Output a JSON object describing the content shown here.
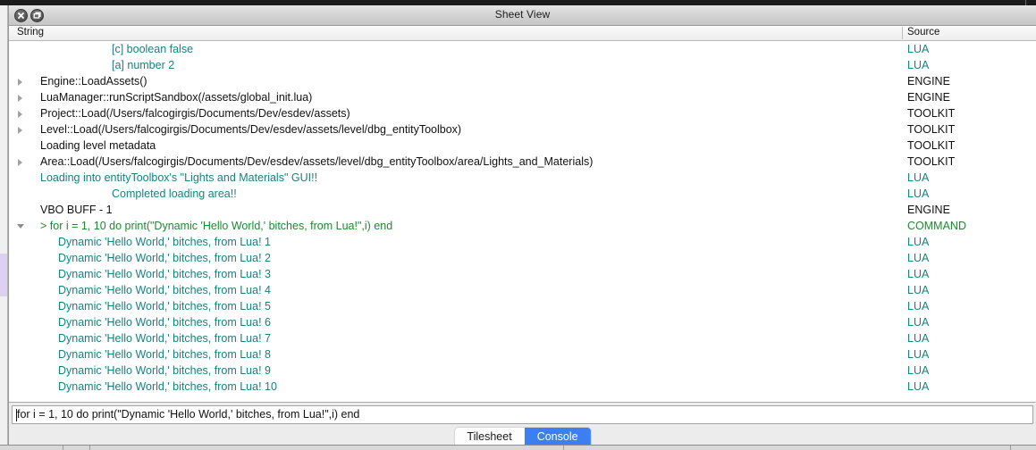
{
  "window": {
    "title": "Sheet View",
    "close_icon": "close-icon",
    "restore_icon": "restore-window-icon"
  },
  "columns": {
    "string": "String",
    "source": "Source"
  },
  "rows": [
    {
      "text": "[c] boolean false",
      "source": "LUA",
      "indent": 3,
      "color": "lua",
      "twisty": "none"
    },
    {
      "text": "[a] number 2",
      "source": "LUA",
      "indent": 3,
      "color": "lua",
      "twisty": "none"
    },
    {
      "text": "Engine::LoadAssets()",
      "source": "ENGINE",
      "indent": 1,
      "color": "plain",
      "twisty": "closed"
    },
    {
      "text": "LuaManager::runScriptSandbox(/assets/global_init.lua)",
      "source": "ENGINE",
      "indent": 1,
      "color": "plain",
      "twisty": "closed"
    },
    {
      "text": "Project::Load(/Users/falcogirgis/Documents/Dev/esdev/assets)",
      "source": "TOOLKIT",
      "indent": 1,
      "color": "plain",
      "twisty": "closed"
    },
    {
      "text": "Level::Load(/Users/falcogirgis/Documents/Dev/esdev/assets/level/dbg_entityToolbox)",
      "source": "TOOLKIT",
      "indent": 1,
      "color": "plain",
      "twisty": "closed"
    },
    {
      "text": "Loading level metadata",
      "source": "TOOLKIT",
      "indent": 1,
      "color": "plain",
      "twisty": "none"
    },
    {
      "text": "Area::Load(/Users/falcogirgis/Documents/Dev/esdev/assets/level/dbg_entityToolbox/area/Lights_and_Materials)",
      "source": "TOOLKIT",
      "indent": 1,
      "color": "plain",
      "twisty": "closed"
    },
    {
      "text": "Loading into entityToolbox's \"Lights and Materials\" GUI!!",
      "source": "LUA",
      "indent": 1,
      "color": "lua",
      "twisty": "none"
    },
    {
      "text": "Completed loading area!!",
      "source": "LUA",
      "indent": 3,
      "color": "lua",
      "twisty": "none"
    },
    {
      "text": "VBO BUFF - 1",
      "source": "ENGINE",
      "indent": 1,
      "color": "plain",
      "twisty": "none"
    },
    {
      "text": "> for i = 1, 10 do print(\"Dynamic 'Hello World,' bitches, from Lua!\",i) end",
      "source": "COMMAND",
      "indent": 1,
      "color": "cmd",
      "twisty": "open"
    },
    {
      "text": "Dynamic 'Hello World,' bitches, from Lua! 1",
      "source": "LUA",
      "indent": 2,
      "color": "lua",
      "twisty": "none"
    },
    {
      "text": "Dynamic 'Hello World,' bitches, from Lua! 2",
      "source": "LUA",
      "indent": 2,
      "color": "lua",
      "twisty": "none"
    },
    {
      "text": "Dynamic 'Hello World,' bitches, from Lua! 3",
      "source": "LUA",
      "indent": 2,
      "color": "lua",
      "twisty": "none"
    },
    {
      "text": "Dynamic 'Hello World,' bitches, from Lua! 4",
      "source": "LUA",
      "indent": 2,
      "color": "lua",
      "twisty": "none"
    },
    {
      "text": "Dynamic 'Hello World,' bitches, from Lua! 5",
      "source": "LUA",
      "indent": 2,
      "color": "lua",
      "twisty": "none"
    },
    {
      "text": "Dynamic 'Hello World,' bitches, from Lua! 6",
      "source": "LUA",
      "indent": 2,
      "color": "lua",
      "twisty": "none"
    },
    {
      "text": "Dynamic 'Hello World,' bitches, from Lua! 7",
      "source": "LUA",
      "indent": 2,
      "color": "lua",
      "twisty": "none"
    },
    {
      "text": "Dynamic 'Hello World,' bitches, from Lua! 8",
      "source": "LUA",
      "indent": 2,
      "color": "lua",
      "twisty": "none"
    },
    {
      "text": "Dynamic 'Hello World,' bitches, from Lua! 9",
      "source": "LUA",
      "indent": 2,
      "color": "lua",
      "twisty": "none"
    },
    {
      "text": "Dynamic 'Hello World,' bitches, from Lua! 10",
      "source": "LUA",
      "indent": 2,
      "color": "lua",
      "twisty": "none"
    }
  ],
  "command_input": {
    "value": "for i = 1, 10 do print(\"Dynamic 'Hello World,' bitches, from Lua!\",i) end",
    "placeholder": ""
  },
  "tabs": [
    {
      "label": "Tilesheet",
      "active": false
    },
    {
      "label": "Console",
      "active": true
    }
  ],
  "colors": {
    "lua_text": "#1a7f80",
    "command_text": "#1d8a2e",
    "plain_text": "#111111",
    "tab_active_bg": "#3b7ff2",
    "scrollbar_thumb": "#ddd0f2"
  }
}
